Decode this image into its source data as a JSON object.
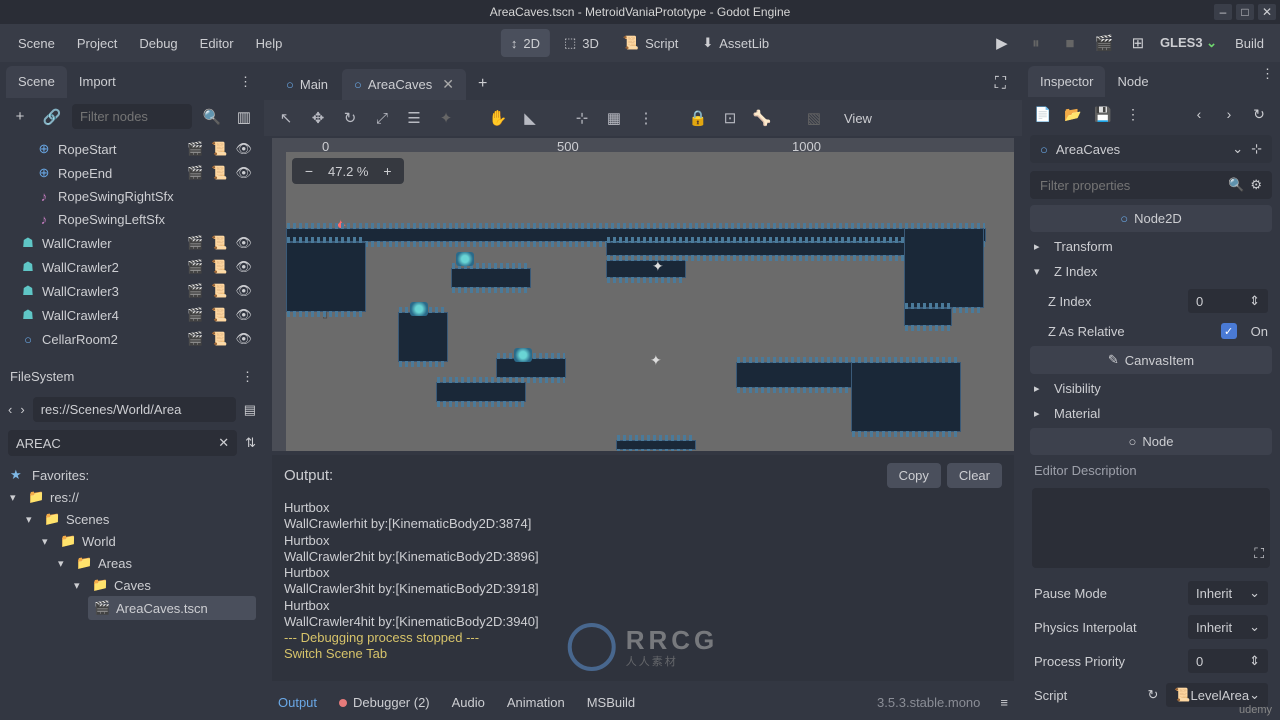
{
  "titlebar": {
    "title": "AreaCaves.tscn - MetroidVaniaPrototype - Godot Engine"
  },
  "menu": {
    "items": [
      "Scene",
      "Project",
      "Debug",
      "Editor",
      "Help"
    ]
  },
  "workspace": {
    "tabs": [
      {
        "label": "2D",
        "active": true
      },
      {
        "label": "3D"
      },
      {
        "label": "Script"
      },
      {
        "label": "AssetLib"
      }
    ]
  },
  "topright": {
    "gles": "GLES3",
    "build": "Build"
  },
  "scene_dock": {
    "tabs": [
      {
        "label": "Scene",
        "active": true
      },
      {
        "label": "Import"
      }
    ],
    "filter_placeholder": "Filter nodes",
    "nodes": [
      {
        "icon": "pos",
        "cls": "ico-blue",
        "label": "RopeStart",
        "indent": 24,
        "icons": [
          "film",
          "script",
          "eye"
        ]
      },
      {
        "icon": "pos",
        "cls": "ico-blue",
        "label": "RopeEnd",
        "indent": 24,
        "icons": [
          "film",
          "script",
          "eye"
        ]
      },
      {
        "icon": "audio",
        "cls": "ico-mag",
        "label": "RopeSwingRightSfx",
        "indent": 24,
        "icons": []
      },
      {
        "icon": "audio",
        "cls": "ico-mag",
        "label": "RopeSwingLeftSfx",
        "indent": 24,
        "icons": []
      },
      {
        "icon": "body",
        "cls": "ico-teal",
        "label": "WallCrawler",
        "indent": 8,
        "icons": [
          "film",
          "script",
          "eye"
        ]
      },
      {
        "icon": "body",
        "cls": "ico-teal",
        "label": "WallCrawler2",
        "indent": 8,
        "icons": [
          "film",
          "script",
          "eye"
        ]
      },
      {
        "icon": "body",
        "cls": "ico-teal",
        "label": "WallCrawler3",
        "indent": 8,
        "icons": [
          "film",
          "script",
          "eye"
        ]
      },
      {
        "icon": "body",
        "cls": "ico-teal",
        "label": "WallCrawler4",
        "indent": 8,
        "icons": [
          "film",
          "script",
          "eye"
        ]
      },
      {
        "icon": "node2d",
        "cls": "ico-blue",
        "label": "CellarRoom2",
        "indent": 8,
        "icons": [
          "film",
          "script",
          "eye"
        ]
      }
    ]
  },
  "filesystem": {
    "title": "FileSystem",
    "path": "res://Scenes/World/Area",
    "filter": "AREAC",
    "favorites": "Favorites:",
    "tree": [
      {
        "label": "res://",
        "indent": 0,
        "icon": "folder",
        "exp": "▾"
      },
      {
        "label": "Scenes",
        "indent": 16,
        "icon": "folder",
        "exp": "▾"
      },
      {
        "label": "World",
        "indent": 32,
        "icon": "folder",
        "exp": "▾"
      },
      {
        "label": "Areas",
        "indent": 48,
        "icon": "folder",
        "exp": "▾"
      },
      {
        "label": "Caves",
        "indent": 64,
        "icon": "folder",
        "exp": "▾"
      },
      {
        "label": "AreaCaves.tscn",
        "indent": 80,
        "icon": "scene",
        "file": true
      }
    ]
  },
  "scene_tabs": [
    {
      "label": "Main"
    },
    {
      "label": "AreaCaves",
      "active": true,
      "close": true
    }
  ],
  "viewport": {
    "zoom": "47.2 %",
    "ruler": [
      "0",
      "500",
      "1000"
    ],
    "view_label": "View"
  },
  "output": {
    "title": "Output:",
    "copy": "Copy",
    "clear": "Clear",
    "lines": [
      {
        "t": "Hurtbox"
      },
      {
        "t": "WallCrawlerhit by:[KinematicBody2D:3874]"
      },
      {
        "t": "Hurtbox"
      },
      {
        "t": "WallCrawler2hit by:[KinematicBody2D:3896]"
      },
      {
        "t": "Hurtbox"
      },
      {
        "t": "WallCrawler3hit by:[KinematicBody2D:3918]"
      },
      {
        "t": "Hurtbox"
      },
      {
        "t": "WallCrawler4hit by:[KinematicBody2D:3940]"
      },
      {
        "t": "--- Debugging process stopped ---",
        "cls": "yellow"
      },
      {
        "t": "Switch Scene Tab",
        "cls": "yellow"
      }
    ]
  },
  "bottom": {
    "tabs": [
      "Output",
      "Debugger (2)",
      "Audio",
      "Animation",
      "MSBuild"
    ],
    "version": "3.5.3.stable.mono"
  },
  "inspector": {
    "tabs": [
      {
        "label": "Inspector",
        "active": true
      },
      {
        "label": "Node"
      }
    ],
    "node": "AreaCaves",
    "filter_placeholder": "Filter properties",
    "class_node2d": "Node2D",
    "transform": "Transform",
    "zindex_label": "Z Index",
    "zindex": {
      "label": "Z Index",
      "value": "0"
    },
    "zrel": {
      "label": "Z As Relative",
      "value": "On"
    },
    "class_canvas": "CanvasItem",
    "visibility": "Visibility",
    "material": "Material",
    "class_node": "Node",
    "desc_label": "Editor Description",
    "pause": {
      "label": "Pause Mode",
      "value": "Inherit"
    },
    "physics": {
      "label": "Physics Interpolat",
      "value": "Inherit"
    },
    "priority": {
      "label": "Process Priority",
      "value": "0"
    },
    "script": {
      "label": "Script",
      "value": "LevelArea"
    }
  },
  "watermark": {
    "text": "RRCG",
    "sub": "人人素材"
  },
  "udemy": "udemy"
}
